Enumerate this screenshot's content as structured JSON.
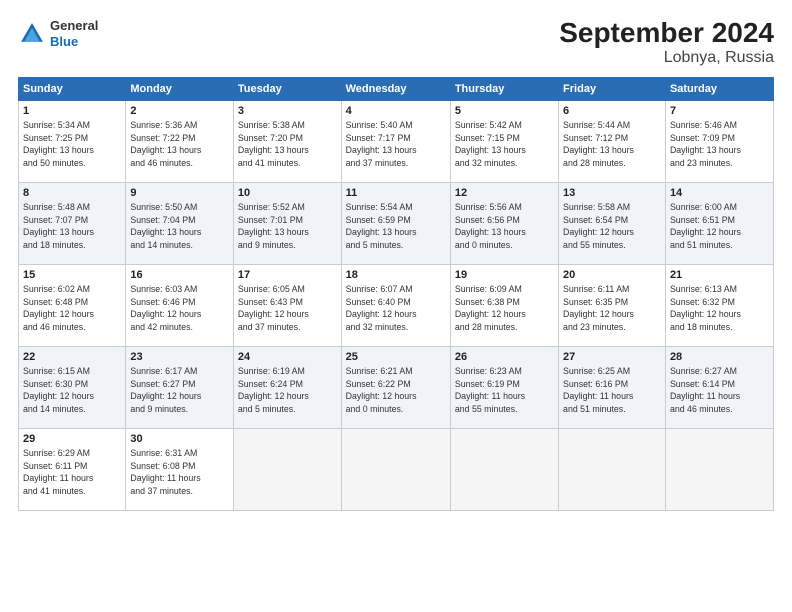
{
  "logo": {
    "general": "General",
    "blue": "Blue"
  },
  "title": "September 2024",
  "subtitle": "Lobnya, Russia",
  "weekdays": [
    "Sunday",
    "Monday",
    "Tuesday",
    "Wednesday",
    "Thursday",
    "Friday",
    "Saturday"
  ],
  "weeks": [
    [
      {
        "day": "1",
        "info": "Sunrise: 5:34 AM\nSunset: 7:25 PM\nDaylight: 13 hours\nand 50 minutes."
      },
      {
        "day": "2",
        "info": "Sunrise: 5:36 AM\nSunset: 7:22 PM\nDaylight: 13 hours\nand 46 minutes."
      },
      {
        "day": "3",
        "info": "Sunrise: 5:38 AM\nSunset: 7:20 PM\nDaylight: 13 hours\nand 41 minutes."
      },
      {
        "day": "4",
        "info": "Sunrise: 5:40 AM\nSunset: 7:17 PM\nDaylight: 13 hours\nand 37 minutes."
      },
      {
        "day": "5",
        "info": "Sunrise: 5:42 AM\nSunset: 7:15 PM\nDaylight: 13 hours\nand 32 minutes."
      },
      {
        "day": "6",
        "info": "Sunrise: 5:44 AM\nSunset: 7:12 PM\nDaylight: 13 hours\nand 28 minutes."
      },
      {
        "day": "7",
        "info": "Sunrise: 5:46 AM\nSunset: 7:09 PM\nDaylight: 13 hours\nand 23 minutes."
      }
    ],
    [
      {
        "day": "8",
        "info": "Sunrise: 5:48 AM\nSunset: 7:07 PM\nDaylight: 13 hours\nand 18 minutes."
      },
      {
        "day": "9",
        "info": "Sunrise: 5:50 AM\nSunset: 7:04 PM\nDaylight: 13 hours\nand 14 minutes."
      },
      {
        "day": "10",
        "info": "Sunrise: 5:52 AM\nSunset: 7:01 PM\nDaylight: 13 hours\nand 9 minutes."
      },
      {
        "day": "11",
        "info": "Sunrise: 5:54 AM\nSunset: 6:59 PM\nDaylight: 13 hours\nand 5 minutes."
      },
      {
        "day": "12",
        "info": "Sunrise: 5:56 AM\nSunset: 6:56 PM\nDaylight: 13 hours\nand 0 minutes."
      },
      {
        "day": "13",
        "info": "Sunrise: 5:58 AM\nSunset: 6:54 PM\nDaylight: 12 hours\nand 55 minutes."
      },
      {
        "day": "14",
        "info": "Sunrise: 6:00 AM\nSunset: 6:51 PM\nDaylight: 12 hours\nand 51 minutes."
      }
    ],
    [
      {
        "day": "15",
        "info": "Sunrise: 6:02 AM\nSunset: 6:48 PM\nDaylight: 12 hours\nand 46 minutes."
      },
      {
        "day": "16",
        "info": "Sunrise: 6:03 AM\nSunset: 6:46 PM\nDaylight: 12 hours\nand 42 minutes."
      },
      {
        "day": "17",
        "info": "Sunrise: 6:05 AM\nSunset: 6:43 PM\nDaylight: 12 hours\nand 37 minutes."
      },
      {
        "day": "18",
        "info": "Sunrise: 6:07 AM\nSunset: 6:40 PM\nDaylight: 12 hours\nand 32 minutes."
      },
      {
        "day": "19",
        "info": "Sunrise: 6:09 AM\nSunset: 6:38 PM\nDaylight: 12 hours\nand 28 minutes."
      },
      {
        "day": "20",
        "info": "Sunrise: 6:11 AM\nSunset: 6:35 PM\nDaylight: 12 hours\nand 23 minutes."
      },
      {
        "day": "21",
        "info": "Sunrise: 6:13 AM\nSunset: 6:32 PM\nDaylight: 12 hours\nand 18 minutes."
      }
    ],
    [
      {
        "day": "22",
        "info": "Sunrise: 6:15 AM\nSunset: 6:30 PM\nDaylight: 12 hours\nand 14 minutes."
      },
      {
        "day": "23",
        "info": "Sunrise: 6:17 AM\nSunset: 6:27 PM\nDaylight: 12 hours\nand 9 minutes."
      },
      {
        "day": "24",
        "info": "Sunrise: 6:19 AM\nSunset: 6:24 PM\nDaylight: 12 hours\nand 5 minutes."
      },
      {
        "day": "25",
        "info": "Sunrise: 6:21 AM\nSunset: 6:22 PM\nDaylight: 12 hours\nand 0 minutes."
      },
      {
        "day": "26",
        "info": "Sunrise: 6:23 AM\nSunset: 6:19 PM\nDaylight: 11 hours\nand 55 minutes."
      },
      {
        "day": "27",
        "info": "Sunrise: 6:25 AM\nSunset: 6:16 PM\nDaylight: 11 hours\nand 51 minutes."
      },
      {
        "day": "28",
        "info": "Sunrise: 6:27 AM\nSunset: 6:14 PM\nDaylight: 11 hours\nand 46 minutes."
      }
    ],
    [
      {
        "day": "29",
        "info": "Sunrise: 6:29 AM\nSunset: 6:11 PM\nDaylight: 11 hours\nand 41 minutes."
      },
      {
        "day": "30",
        "info": "Sunrise: 6:31 AM\nSunset: 6:08 PM\nDaylight: 11 hours\nand 37 minutes."
      },
      {
        "day": "",
        "info": ""
      },
      {
        "day": "",
        "info": ""
      },
      {
        "day": "",
        "info": ""
      },
      {
        "day": "",
        "info": ""
      },
      {
        "day": "",
        "info": ""
      }
    ]
  ]
}
